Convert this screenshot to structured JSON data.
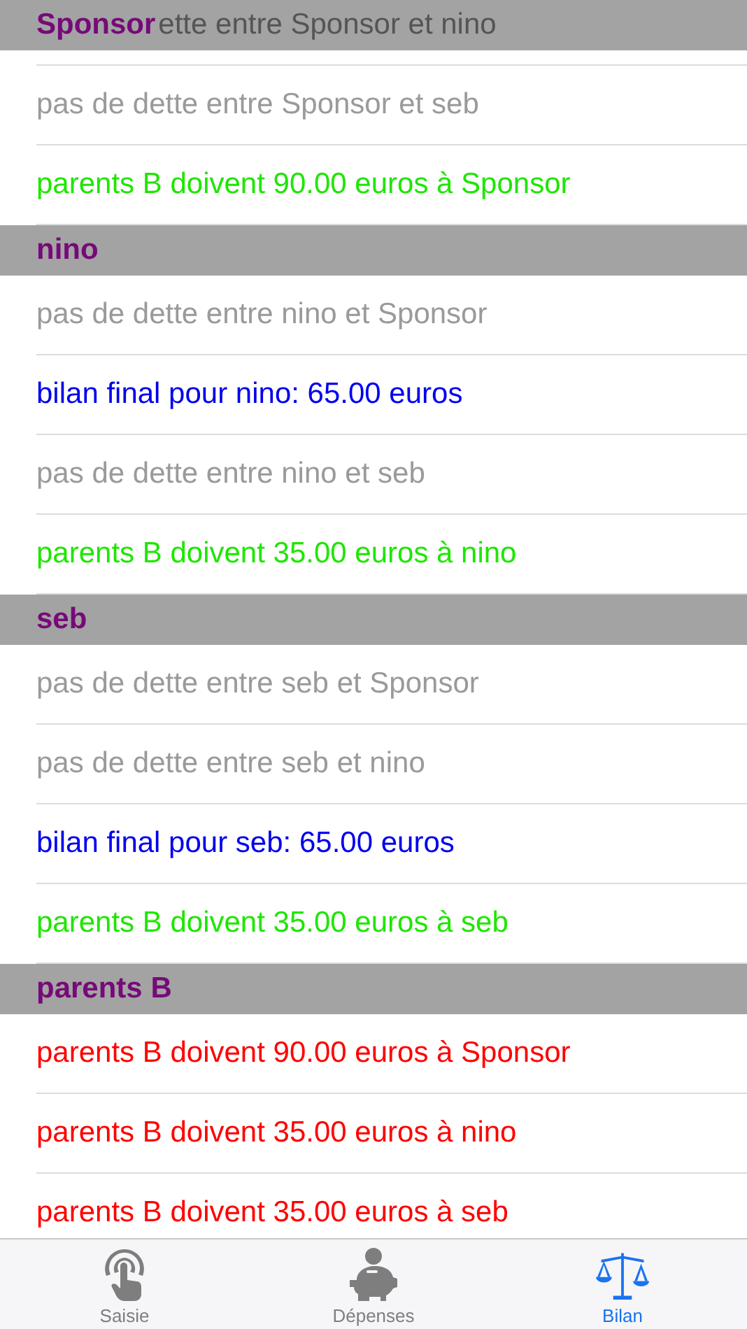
{
  "sections": [
    {
      "title": "Sponsor",
      "behind_text": "ette entre Sponsor et nino",
      "rows": [
        {
          "text": "pas de dette entre Sponsor et seb",
          "kind": "neutral"
        },
        {
          "text": "parents B doivent 90.00 euros à Sponsor",
          "kind": "credit"
        }
      ]
    },
    {
      "title": "nino",
      "rows": [
        {
          "text": "pas de dette entre nino et Sponsor",
          "kind": "neutral"
        },
        {
          "text": "bilan final pour nino: 65.00 euros",
          "kind": "total"
        },
        {
          "text": "pas de dette entre nino et seb",
          "kind": "neutral"
        },
        {
          "text": "parents B doivent 35.00 euros à nino",
          "kind": "credit"
        }
      ]
    },
    {
      "title": "seb",
      "rows": [
        {
          "text": "pas de dette entre seb et Sponsor",
          "kind": "neutral"
        },
        {
          "text": "pas de dette entre seb et nino",
          "kind": "neutral"
        },
        {
          "text": "bilan final pour seb: 65.00 euros",
          "kind": "total"
        },
        {
          "text": "parents B doivent 35.00 euros à seb",
          "kind": "credit"
        }
      ]
    },
    {
      "title": "parents B",
      "rows": [
        {
          "text": "parents B doivent 90.00 euros à Sponsor",
          "kind": "debt"
        },
        {
          "text": "parents B doivent 35.00 euros à nino",
          "kind": "debt"
        },
        {
          "text": "parents B doivent 35.00 euros à seb",
          "kind": "debt"
        }
      ]
    }
  ],
  "tabs": [
    {
      "label": "Saisie",
      "kind": "touch",
      "selected": false
    },
    {
      "label": "Dépenses",
      "kind": "piggy",
      "selected": false
    },
    {
      "label": "Bilan",
      "kind": "scales",
      "selected": true
    }
  ]
}
